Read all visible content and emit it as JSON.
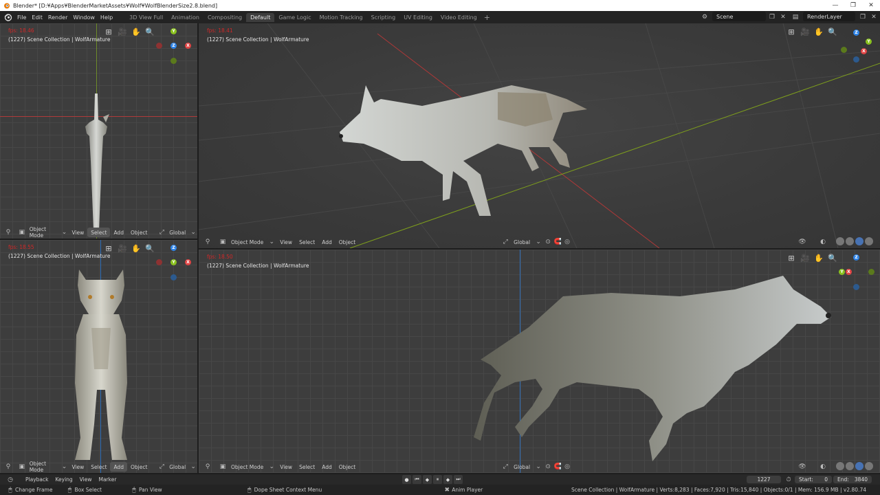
{
  "window": {
    "title": "Blender* [D:¥Apps¥BlenderMarketAssets¥Wolf¥WolfBlenderSize2.8.blend]",
    "controls": [
      "—",
      "❐",
      "✕"
    ]
  },
  "menu": [
    "File",
    "Edit",
    "Render",
    "Window",
    "Help"
  ],
  "workspaces": [
    "3D View Full",
    "Animation",
    "Compositing",
    "Default",
    "Game Logic",
    "Motion Tracking",
    "Scripting",
    "UV Editing",
    "Video Editing"
  ],
  "workspace_active": "Default",
  "workspace_add": "+",
  "scene": "Scene",
  "render_layer": "RenderLayer",
  "viewports": {
    "tl": {
      "fps": "fps: 18.46",
      "collection": "(1227) Scene Collection | WolfArmature"
    },
    "tr": {
      "fps": "fps: 18.41",
      "collection": "(1227) Scene Collection | WolfArmature"
    },
    "bl": {
      "fps": "fps: 18.55",
      "collection": "(1227) Scene Collection | WolfArmature"
    },
    "br": {
      "fps": "fps: 18.50",
      "collection": "(1227) Scene Collection | WolfArmature"
    }
  },
  "viewport_header": {
    "mode": "Object Mode",
    "view": "View",
    "select": "Select",
    "add": "Add",
    "object": "Object",
    "orientation": "Global"
  },
  "gizmo": {
    "x": "X",
    "y": "Y",
    "z": "Z"
  },
  "timeline": {
    "playback": "Playback",
    "keying": "Keying",
    "view": "View",
    "marker": "Marker",
    "current_frame": "1227",
    "start_label": "Start:",
    "start": "0",
    "end_label": "End:",
    "end": "3840"
  },
  "status": {
    "change_frame": "Change Frame",
    "box_select": "Box Select",
    "pan_view": "Pan View",
    "context_menu": "Dope Sheet Context Menu",
    "anim_player": "Anim Player",
    "stats": "Scene Collection | WolfArmature | Verts:8,283 | Faces:7,920 | Tris:15,840 | Objects:0/1 | Mem: 156.9 MB | v2.80.74"
  },
  "colors": {
    "viewport_bg": "#3d3d3d",
    "grid": "#474747",
    "x_axis": "#d23c3c",
    "y_axis": "#8ab517",
    "z_axis": "#2e83e6",
    "fps_text": "#d02828",
    "wolf_fur": "#b9bdbc",
    "wolf_back": "#8a8470"
  }
}
